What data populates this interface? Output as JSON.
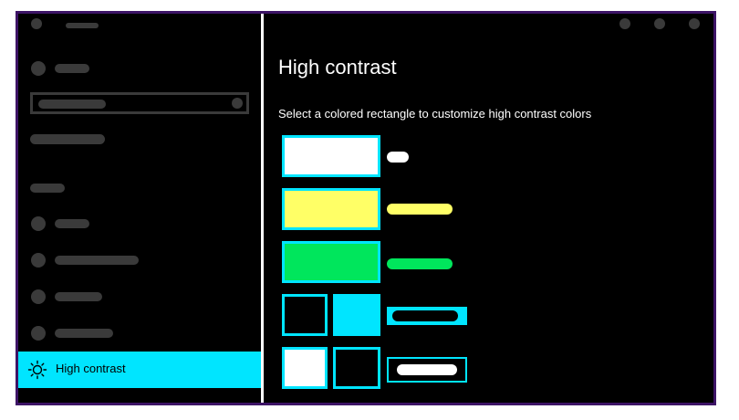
{
  "colors": {
    "background": "#000000",
    "accent": "#00e5ff",
    "placeholder": "#3a3a3a",
    "frame_border": "#3d1466",
    "text": "#ffffff",
    "white": "#ffffff",
    "yellow": "#ffff66",
    "green": "#00e65c"
  },
  "sidebar": {
    "active_item": {
      "label": "High contrast",
      "icon": "brightness-icon"
    }
  },
  "main": {
    "title": "High contrast",
    "subtitle": "Select a colored rectangle to customize high contrast colors",
    "swatch_rows": [
      {
        "name": "text-color",
        "swatches": [
          "white"
        ],
        "preview": "white-bar"
      },
      {
        "name": "hyperlink-color",
        "swatches": [
          "yellow"
        ],
        "preview": "yellow-bar"
      },
      {
        "name": "disabled-text-color",
        "swatches": [
          "green"
        ],
        "preview": "green-bar"
      },
      {
        "name": "selected-text-color",
        "swatches": [
          "black",
          "cyan"
        ],
        "preview": "cyan-button"
      },
      {
        "name": "button-text-color",
        "swatches": [
          "white",
          "black"
        ],
        "preview": "outlined-button"
      }
    ]
  }
}
